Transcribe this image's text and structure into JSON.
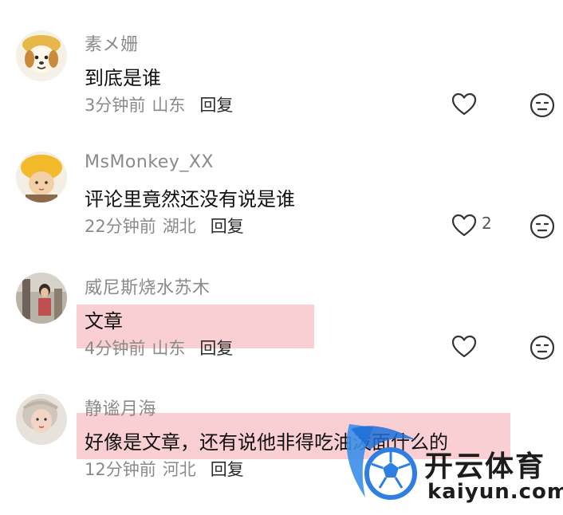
{
  "comments": [
    {
      "username": "素メ姗",
      "text": "到底是谁",
      "time": "3分钟前",
      "location": "山东",
      "reply_label": "回复",
      "likes": ""
    },
    {
      "username": "MsMonkey_XX",
      "text": "评论里竟然还没有说是谁",
      "time": "22分钟前",
      "location": "湖北",
      "reply_label": "回复",
      "likes": "2"
    },
    {
      "username": "威尼斯烧水苏木",
      "text": "文章",
      "time": "4分钟前",
      "location": "山东",
      "reply_label": "回复",
      "likes": ""
    },
    {
      "username": "静谧月海",
      "text": "好像是文章，还有说他非得吃油泼面什么的",
      "time": "12分钟前",
      "location": "河北",
      "reply_label": "回复",
      "likes": ""
    }
  ],
  "watermark": {
    "brand_cn": "开云体育",
    "brand_en": "kaiyun.com"
  },
  "colors": {
    "highlight": "#f08c96",
    "muted_text": "#8a8a8a",
    "watermark_blue": "#2f7fe0"
  },
  "icons": [
    "heart-icon",
    "dislike-face-icon"
  ]
}
